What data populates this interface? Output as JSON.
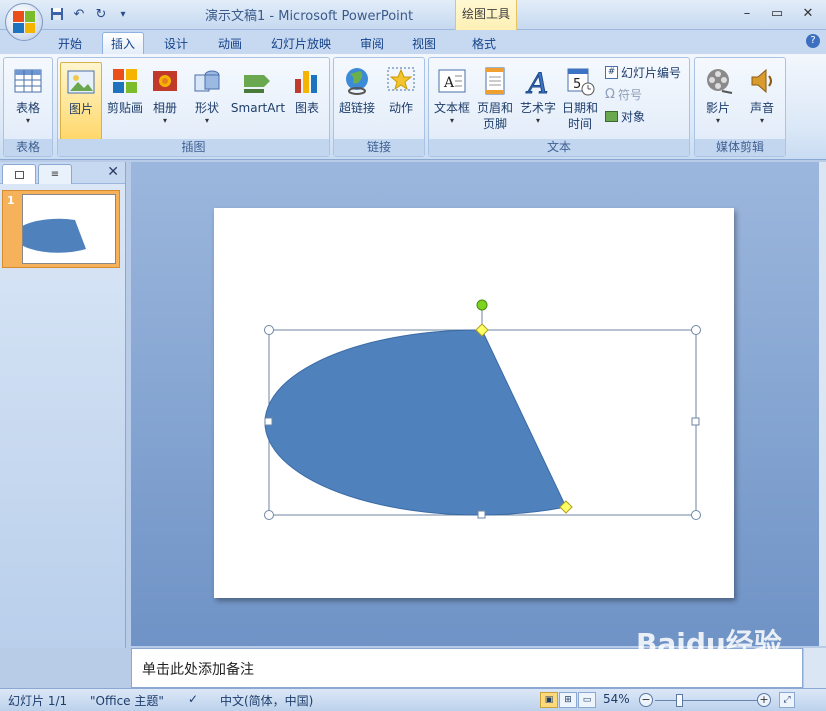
{
  "window": {
    "title": "演示文稿1 - Microsoft PowerPoint",
    "context_tool": "绘图工具",
    "minimize": "–",
    "restore": "▭",
    "close": "✕"
  },
  "qat": {
    "save": "💾",
    "undo": "↶",
    "redo": "↻",
    "more": "▾"
  },
  "tabs": [
    "开始",
    "插入",
    "设计",
    "动画",
    "幻灯片放映",
    "审阅",
    "视图",
    "格式"
  ],
  "active_tab": "插入",
  "ribbon": {
    "groups": {
      "table": "表格",
      "illustrations": "插图",
      "links": "链接",
      "text": "文本",
      "media": "媒体剪辑"
    },
    "buttons": {
      "table": "表格",
      "picture": "图片",
      "clipart": "剪贴画",
      "album": "相册",
      "shapes": "形状",
      "smartart": "SmartArt",
      "chart": "图表",
      "hyperlink": "超链接",
      "action": "动作",
      "textbox": "文本框",
      "header_footer_1": "页眉和",
      "header_footer_2": "页脚",
      "wordart": "艺术字",
      "datetime_1": "日期和",
      "datetime_2": "时间",
      "slide_number": "幻灯片编号",
      "symbol": "符号",
      "object": "对象",
      "movie": "影片",
      "sound": "声音"
    }
  },
  "slide_pane": {
    "slide_index": "1"
  },
  "notes_placeholder": "单击此处添加备注",
  "status": {
    "slide": "幻灯片 1/1",
    "theme": "\"Office 主题\"",
    "language": "中文(简体，中国)",
    "zoom": "54%"
  },
  "watermark": "Baidu经验",
  "colors": {
    "shape_fill": "#4f81bd",
    "shape_stroke": "#3a6aa5",
    "handle_green": "#7ed321",
    "handle_yellow": "#ffff66"
  }
}
